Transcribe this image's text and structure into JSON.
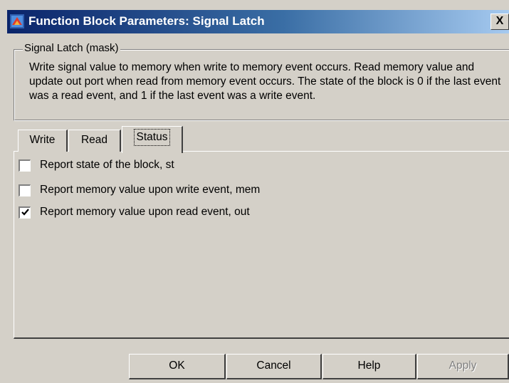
{
  "window": {
    "title": "Function Block Parameters: Signal Latch",
    "close_label": "X"
  },
  "group": {
    "legend": "Signal Latch (mask)",
    "description": "Write signal value to memory when write to memory event occurs. Read memory value and update out port when read from memory event occurs. The state of the block is 0 if the last event was a read event, and 1 if the last event was a write event."
  },
  "tabs": [
    {
      "label": "Write",
      "selected": false
    },
    {
      "label": "Read",
      "selected": false
    },
    {
      "label": "Status",
      "selected": true
    }
  ],
  "checkboxes": [
    {
      "label": "Report state of the block, st",
      "checked": false
    },
    {
      "label": "Report memory value upon write event, mem",
      "checked": false
    },
    {
      "label": "Report memory value upon read event, out",
      "checked": true
    }
  ],
  "buttons": {
    "ok": "OK",
    "cancel": "Cancel",
    "help": "Help",
    "apply": "Apply"
  },
  "colors": {
    "titlebar_start": "#0a246a",
    "titlebar_end": "#a6caf0",
    "face": "#d4d0c8"
  },
  "icons": {
    "title": "simulink-block-icon",
    "check": "checkmark-icon"
  }
}
